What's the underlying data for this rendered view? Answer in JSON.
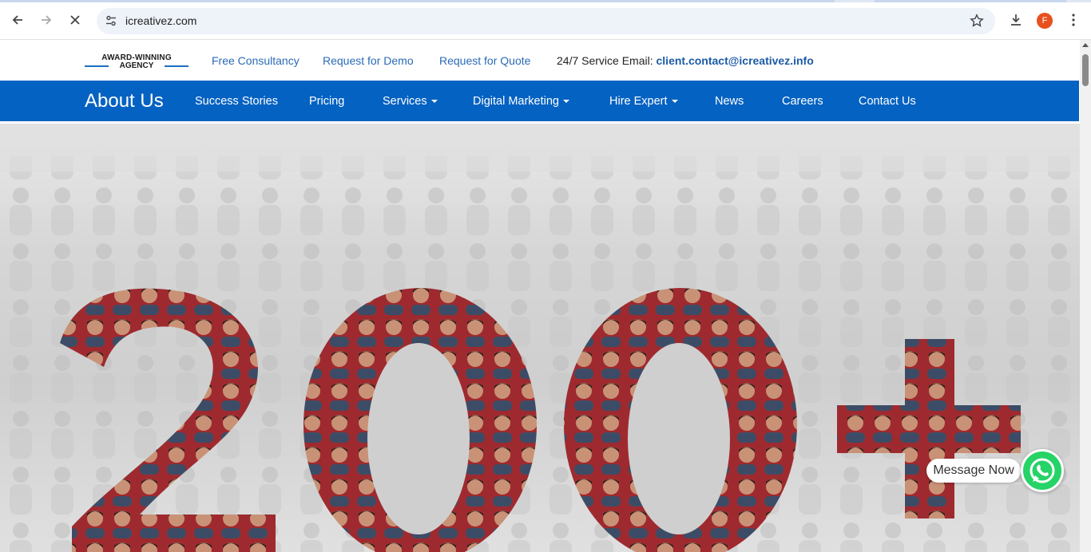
{
  "browser": {
    "url": "icreativez.com",
    "avatar_letter": "F"
  },
  "infobar": {
    "logo_line1": "AWARD-WINNING",
    "logo_line2": "AGENCY",
    "links": [
      "Free Consultancy",
      "Request for Demo",
      "Request for Quote"
    ],
    "email_label": "24/7 Service Email:",
    "email": "client.contact@icreativez.info"
  },
  "nav": {
    "brand": "About Us",
    "items": [
      {
        "label": "Success Stories"
      },
      {
        "label": "Pricing"
      },
      {
        "label": "Services"
      },
      {
        "label": "Digital Marketing"
      },
      {
        "label": "Hire Expert"
      },
      {
        "label": "News"
      },
      {
        "label": "Careers"
      },
      {
        "label": "Contact Us"
      }
    ]
  },
  "hero": {
    "caption": "200+"
  },
  "widget": {
    "message_label": "Message Now"
  },
  "colors": {
    "nav_blue": "#0462c2",
    "link_blue": "#2a6ab6",
    "digit_red": "#9e2a2f",
    "whatsapp_green": "#25d366"
  }
}
